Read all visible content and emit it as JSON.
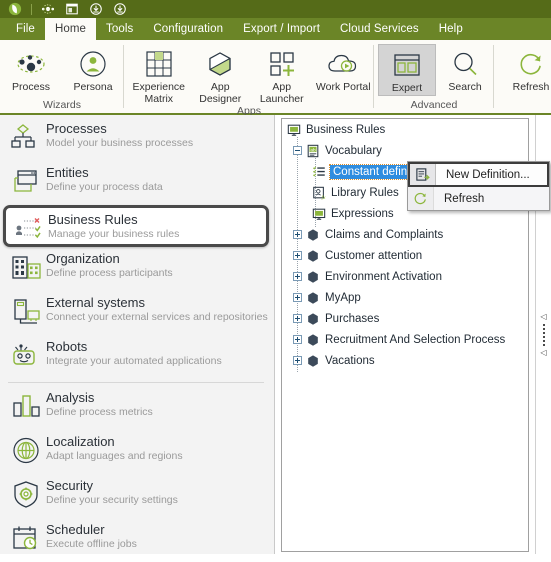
{
  "quick_access": {
    "app_icon": "bizagi-logo-icon",
    "buttons": [
      {
        "name": "share-icon"
      },
      {
        "name": "window-icon"
      },
      {
        "name": "download-icon"
      },
      {
        "name": "download-alt-icon"
      }
    ]
  },
  "menubar": {
    "items": [
      {
        "label": "File",
        "active": false
      },
      {
        "label": "Home",
        "active": true
      },
      {
        "label": "Tools",
        "active": false
      },
      {
        "label": "Configuration",
        "active": false
      },
      {
        "label": "Export / Import",
        "active": false
      },
      {
        "label": "Cloud Services",
        "active": false
      },
      {
        "label": "Help",
        "active": false
      }
    ]
  },
  "ribbon": {
    "groups": [
      {
        "title": "Wizards",
        "buttons": [
          {
            "label": "Process",
            "icon": "process-nodes-icon",
            "selected": false
          },
          {
            "label": "Persona",
            "icon": "persona-icon",
            "selected": false
          }
        ]
      },
      {
        "title": "Apps",
        "buttons": [
          {
            "label": "Experience Matrix",
            "icon": "matrix-grid-icon",
            "selected": false
          },
          {
            "label": "App Designer",
            "icon": "hexagon-icon",
            "selected": false
          },
          {
            "label": "App Launcher",
            "icon": "app-launcher-icon",
            "selected": false
          },
          {
            "label": "Work Portal",
            "icon": "cloud-play-icon",
            "selected": false
          }
        ]
      },
      {
        "title": "Advanced",
        "buttons": [
          {
            "label": "Expert",
            "icon": "expert-panels-icon",
            "selected": true
          },
          {
            "label": "Search",
            "icon": "magnifier-icon",
            "selected": false
          }
        ]
      },
      {
        "title": "",
        "buttons": [
          {
            "label": "Refresh",
            "icon": "refresh-arrow-icon",
            "selected": false
          }
        ]
      }
    ]
  },
  "sidebar": {
    "items": [
      {
        "title": "Processes",
        "subtitle": "Model your business processes",
        "icon": "process-tree-icon",
        "selected": false,
        "separator_after": false
      },
      {
        "title": "Entities",
        "subtitle": "Define your process data",
        "icon": "entities-window-icon",
        "selected": false,
        "separator_after": false
      },
      {
        "title": "Business  Rules",
        "subtitle": "Manage your business rules",
        "icon": "business-rules-icon",
        "selected": true,
        "separator_after": false
      },
      {
        "title": "Organization",
        "subtitle": "Define process participants",
        "icon": "organization-buildings-icon",
        "selected": false,
        "separator_after": false
      },
      {
        "title": "External systems",
        "subtitle": "Connect your external services and repositories",
        "icon": "external-systems-icon",
        "selected": false,
        "separator_after": false
      },
      {
        "title": "Robots",
        "subtitle": "Integrate your automated applications",
        "icon": "robot-icon",
        "selected": false,
        "separator_after": true
      },
      {
        "title": "Analysis",
        "subtitle": "Define  process  metrics",
        "icon": "analysis-bars-icon",
        "selected": false,
        "separator_after": false
      },
      {
        "title": "Localization",
        "subtitle": "Adapt  languages  and  regions",
        "icon": "globe-icon",
        "selected": false,
        "separator_after": false
      },
      {
        "title": "Security",
        "subtitle": "Define  your  security  settings",
        "icon": "shield-gear-icon",
        "selected": false,
        "separator_after": false
      },
      {
        "title": "Scheduler",
        "subtitle": "Execute  offline  jobs",
        "icon": "calendar-clock-icon",
        "selected": false,
        "separator_after": false
      }
    ]
  },
  "tree": {
    "nodes": [
      {
        "label": "Business Rules",
        "depth": 0,
        "expander": "none",
        "icon": "monitor-icon",
        "selected": false
      },
      {
        "label": "Vocabulary",
        "depth": 1,
        "expander": "minus",
        "icon": "vocabulary-ab-icon",
        "selected": false
      },
      {
        "label": "Constant defin",
        "depth": 2,
        "expander": "none",
        "icon": "list-checks-icon",
        "selected": true
      },
      {
        "label": "Library Rules",
        "depth": 2,
        "expander": "none",
        "icon": "library-rules-icon",
        "selected": false
      },
      {
        "label": "Expressions",
        "depth": 2,
        "expander": "none",
        "icon": "monitor-icon",
        "selected": false
      },
      {
        "label": "Claims and Complaints",
        "depth": 1,
        "expander": "plus",
        "icon": "hexagon-solid-icon",
        "selected": false
      },
      {
        "label": "Customer attention",
        "depth": 1,
        "expander": "plus",
        "icon": "hexagon-solid-icon",
        "selected": false
      },
      {
        "label": "Environment Activation",
        "depth": 1,
        "expander": "plus",
        "icon": "hexagon-solid-icon",
        "selected": false
      },
      {
        "label": "MyApp",
        "depth": 1,
        "expander": "plus",
        "icon": "hexagon-solid-icon",
        "selected": false
      },
      {
        "label": "Purchases",
        "depth": 1,
        "expander": "plus",
        "icon": "hexagon-solid-icon",
        "selected": false
      },
      {
        "label": "Recruitment And Selection Process",
        "depth": 1,
        "expander": "plus",
        "icon": "hexagon-solid-icon",
        "selected": false
      },
      {
        "label": "Vacations",
        "depth": 1,
        "expander": "plus",
        "icon": "hexagon-solid-icon",
        "selected": false
      }
    ]
  },
  "context_menu": {
    "items": [
      {
        "label": "New Definition...",
        "icon": "new-definition-icon",
        "highlighted": true
      },
      {
        "label": "Refresh",
        "icon": "refresh-arrow-icon",
        "highlighted": false
      }
    ]
  },
  "colors": {
    "brand_dark_green": "#556B18",
    "menu_green": "#6B8527",
    "accent_green": "#8CB63C",
    "selection_blue": "#2E8DE0",
    "ribbon_bg": "#FCFBF7",
    "sidebar_bg": "#F3F3F3",
    "icon_navy": "#2b3845"
  }
}
